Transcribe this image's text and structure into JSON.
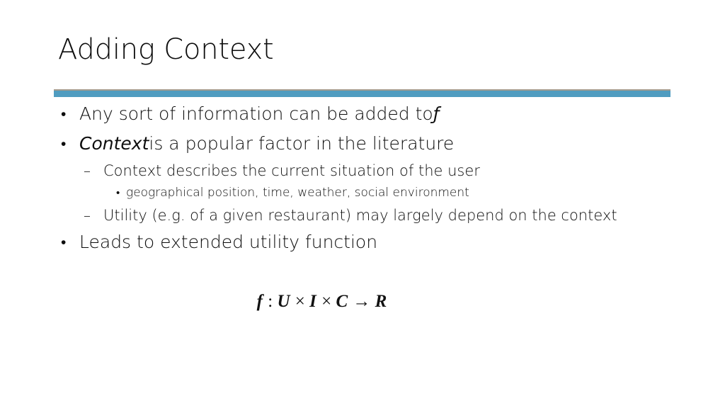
{
  "slide": {
    "title": "Adding Context",
    "background_color": "#ffffff",
    "divider_color": "#509cc0",
    "text_color": "#0d0d0d"
  },
  "bullets": {
    "b1": {
      "marker": "•",
      "text_plain": "Any sort of information can be added to ",
      "emphasis": "ƒ"
    },
    "b2": {
      "marker": "•",
      "emphasis": "Context",
      "text_plain": " is a popular factor in the literature"
    },
    "b3": {
      "marker": "–",
      "text": "Context describes the current situation of the user"
    },
    "b4": {
      "marker": "•",
      "text": "geographical position, time, weather, social environment"
    },
    "b5": {
      "marker": "–",
      "text": "Utility (e.g. of a given restaurant) may largely depend on the context"
    },
    "b6": {
      "marker": "•",
      "text": "Leads to extended utility function"
    }
  },
  "formula": {
    "full": "f : U × I × C → R",
    "domain_function": "f",
    "colon": " : ",
    "term_u": "U",
    "times_1": " × ",
    "term_i": "I",
    "times_2": " × ",
    "term_c": "C",
    "arrow": " → ",
    "term_r": "R"
  }
}
